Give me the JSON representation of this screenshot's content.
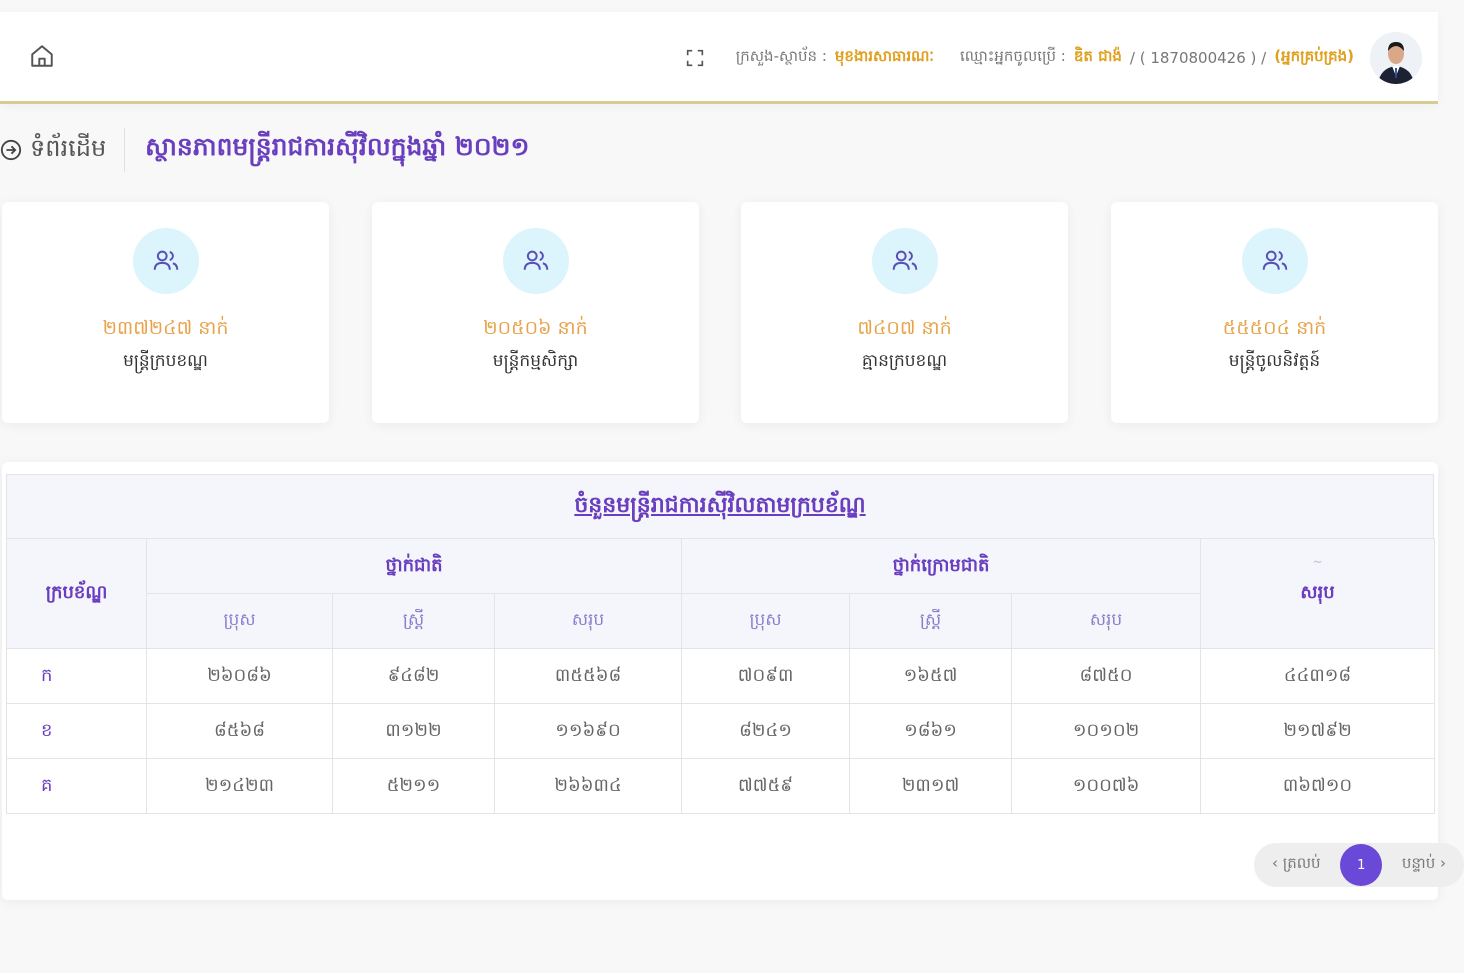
{
  "colors": {
    "accent": "#6a3fbf",
    "stat_value": "#e8a34a",
    "highlight": "#e0a020",
    "header_border": "#d8cb92",
    "icon_bg": "#dcf4fb",
    "page_active": "#6a48d8"
  },
  "header": {
    "home_icon": "home-icon",
    "fullscreen_icon": "fullscreen-icon",
    "ministry_label": "ក្រសួង-ស្ថាប័ន :",
    "ministry_value": "មុខងារសាធារណៈ",
    "user_label": "ឈ្មោះអ្នកចូលប្រើ :",
    "user_name": "ឌិត ជាង៉",
    "user_id": "/ ( 1870800426 ) /",
    "user_role": "(អ្នកគ្រប់គ្រង)"
  },
  "breadcrumb": {
    "home_label": "ទំព័រដើម",
    "page_title": "ស្ថានភាពមន្ត្រីរាជការស៊ីវិលក្នុងឆ្នាំ ២០២១"
  },
  "stats": [
    {
      "icon": "users-icon",
      "value": "២៣៧២៤៧ នាក់",
      "label": "មន្ត្រីក្របខណ្ឌ"
    },
    {
      "icon": "users-icon",
      "value": "២០៥០៦ នាក់",
      "label": "មន្ត្រីកម្មសិក្សា"
    },
    {
      "icon": "users-icon",
      "value": "៧៤០៧ នាក់",
      "label": "គ្មានក្របខណ្ឌ"
    },
    {
      "icon": "users-icon",
      "value": "៥៥៥០៤ នាក់",
      "label": "មន្ត្រីចូលនិវត្តន៍"
    }
  ],
  "table": {
    "caption": "ចំនួនមន្ត្រីរាជការស៊ីវិលតាមក្របខ័ណ្ឌ",
    "row_header": "ក្របខ័ណ្ឌ",
    "group1": "ថ្នាក់ជាតិ",
    "group2": "ថ្នាក់ក្រោមជាតិ",
    "total_header": "សរុប",
    "sub_headers": [
      "ប្រុស",
      "ស្ត្រី",
      "សរុប",
      "ប្រុស",
      "ស្ត្រី",
      "សរុប"
    ],
    "rows": [
      [
        "ក",
        "២៦០៨៦",
        "៩៤៨២",
        "៣៥៥៦៨",
        "៧០៩៣",
        "១៦៥៧",
        "៨៧៥០",
        "៤៤៣១៨"
      ],
      [
        "ខ",
        "៨៥៦៨",
        "៣១២២",
        "១១៦៩០",
        "៨២៤១",
        "១៨៦១",
        "១០១០២",
        "២១៧៩២"
      ],
      [
        "គ",
        "២១៤២៣",
        "៥២១១",
        "២៦៦៣៤",
        "៧៧៥៩",
        "២៣១៧",
        "១០០៧៦",
        "៣៦៧១០"
      ]
    ]
  },
  "pagination": {
    "prev": "‹ ត្រលប់",
    "current": "1",
    "next": "បន្ទាប់ ›"
  }
}
